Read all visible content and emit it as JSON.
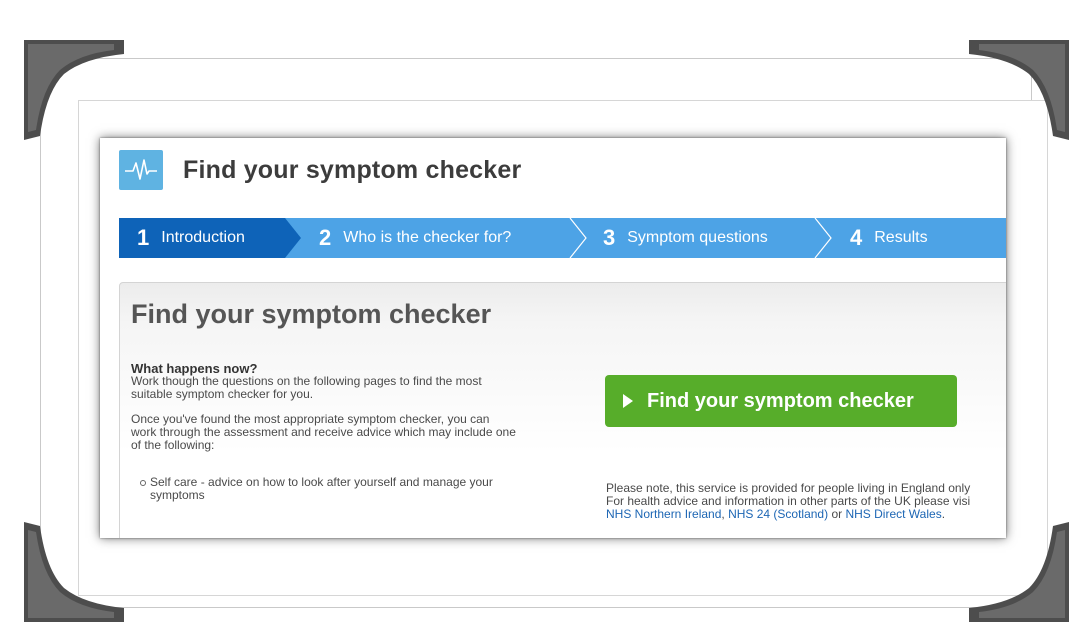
{
  "header": {
    "title": "Find your symptom checker",
    "logo_icon": "heartbeat-icon"
  },
  "steps": [
    {
      "number": "1",
      "label": "Introduction",
      "active": true
    },
    {
      "number": "2",
      "label": "Who is the checker for?",
      "active": false
    },
    {
      "number": "3",
      "label": "Symptom questions",
      "active": false
    },
    {
      "number": "4",
      "label": "Results",
      "active": false
    }
  ],
  "panel": {
    "title": "Find your symptom checker",
    "subheading": "What happens now?",
    "intro_line1": "Work though the questions on the following pages to find the most",
    "intro_line2": "suitable symptom checker for you.",
    "para_line1": "Once you've found the most appropriate symptom checker, you can",
    "para_line2": "work through the assessment and receive advice which may include one",
    "para_line3": "of the following:",
    "bullets": [
      {
        "line1": "Self care - advice on how to look after yourself and manage your",
        "line2": "symptoms"
      }
    ],
    "cta_label": "Find your symptom checker",
    "note_line1": "Please note, this service is provided for people living in England only",
    "note_line2": "For health advice and information in other parts of the UK please visi",
    "links": {
      "ni": "NHS Northern Ireland",
      "sep1": ", ",
      "scotland": "NHS 24 (Scotland)",
      "sep2": " or ",
      "wales": "NHS Direct Wales",
      "end": "."
    }
  },
  "colors": {
    "step_bar": "#4da3e6",
    "step_active": "#0e63b8",
    "cta_green": "#57ad2a",
    "logo_blue": "#5fb3e2",
    "link_blue": "#1d66b4"
  }
}
